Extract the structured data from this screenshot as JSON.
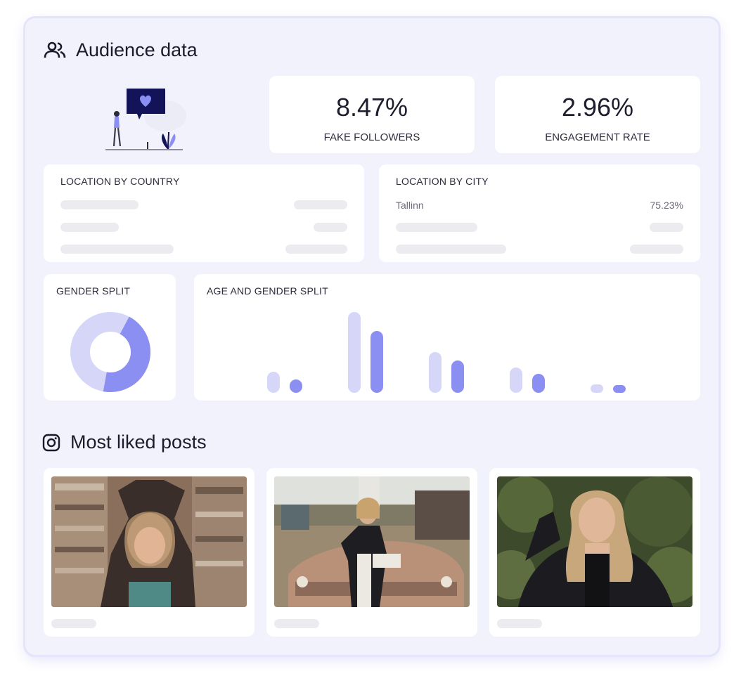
{
  "audience": {
    "title": "Audience data",
    "icon": "users-icon",
    "fake_followers": {
      "value": "8.47%",
      "label": "FAKE FOLLOWERS"
    },
    "engagement_rate": {
      "value": "2.96%",
      "label": "ENGAGEMENT RATE"
    },
    "location_country": {
      "title": "LOCATION BY COUNTRY"
    },
    "location_city": {
      "title": "LOCATION BY CITY",
      "top_city": "Tallinn",
      "top_city_pct": "75.23%"
    },
    "gender_split": {
      "title": "GENDER SPLIT",
      "primary_fraction": 0.45
    },
    "age_gender_split": {
      "title": "AGE AND GENDER SPLIT"
    }
  },
  "posts": {
    "title": "Most liked posts",
    "icon": "instagram-icon"
  },
  "colors": {
    "accent": "#8c8ff2",
    "accent_light": "#d6d7f8",
    "panel_bg": "#f2f2fd",
    "navy": "#0f0f4f"
  }
}
